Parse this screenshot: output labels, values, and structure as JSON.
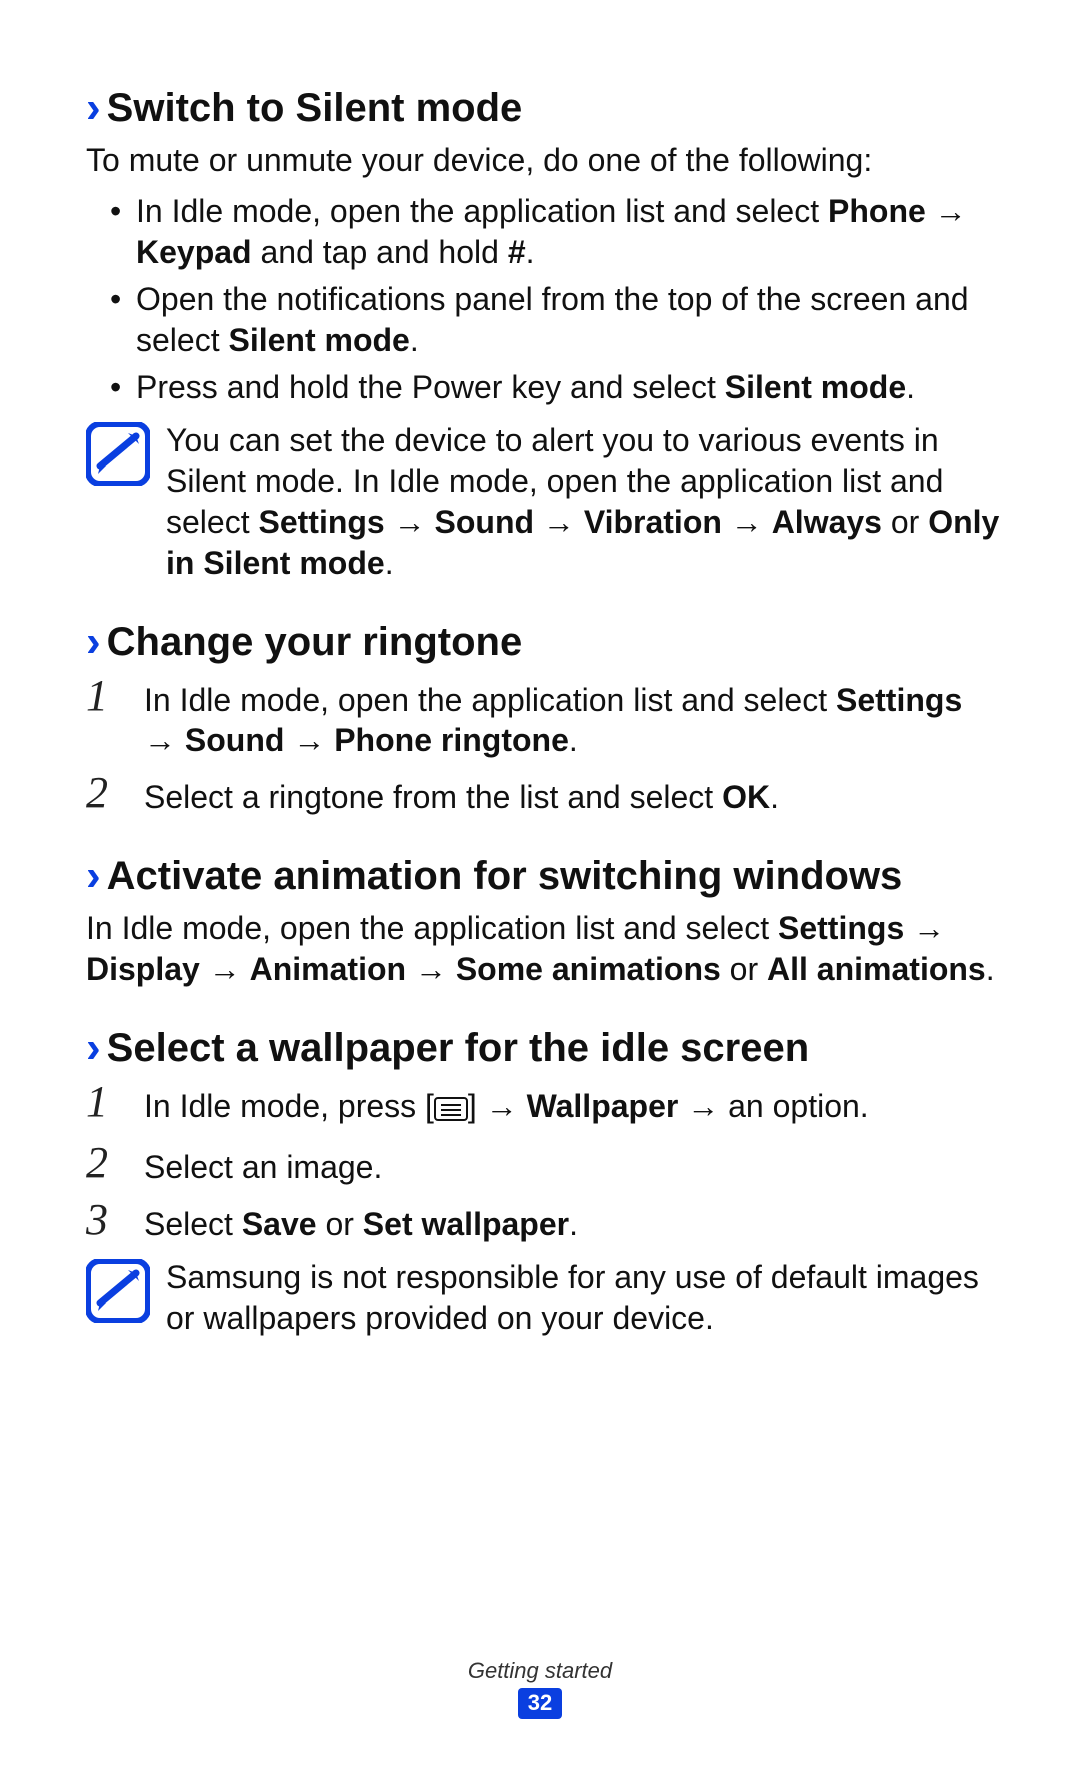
{
  "sections": {
    "silent": {
      "heading": "Switch to Silent mode",
      "intro": "To mute or unmute your device, do one of the following:",
      "bullets": {
        "b1_a": "In Idle mode, open the application list and select ",
        "b1_b": "Phone",
        "b1_c": " → ",
        "b1_d": "Keypad",
        "b1_e": " and tap and hold ",
        "b1_f": "#",
        "b1_g": ".",
        "b2_a": "Open the notifications panel from the top of the screen and select ",
        "b2_b": "Silent mode",
        "b2_c": ".",
        "b3_a": "Press and hold the Power key and select ",
        "b3_b": "Silent mode",
        "b3_c": "."
      },
      "note": {
        "a": "You can set the device to alert you to various events in Silent mode. In Idle mode, open the application list and select ",
        "b": "Settings",
        "c": " → ",
        "d": "Sound",
        "e": " → ",
        "f": "Vibration",
        "g": " → ",
        "h": "Always",
        "i": " or ",
        "j": "Only in Silent mode",
        "k": "."
      }
    },
    "ringtone": {
      "heading": "Change your ringtone",
      "step1": {
        "a": "In Idle mode, open the application list and select ",
        "b": "Settings",
        "c": " → ",
        "d": "Sound",
        "e": " → ",
        "f": "Phone ringtone",
        "g": "."
      },
      "step2": {
        "a": "Select a ringtone from the list and select ",
        "b": "OK",
        "c": "."
      }
    },
    "animation": {
      "heading": "Activate animation for switching windows",
      "text": {
        "a": "In Idle mode, open the application list and select ",
        "b": "Settings",
        "c": " → ",
        "d": "Display",
        "e": " → ",
        "f": "Animation",
        "g": " → ",
        "h": "Some animations",
        "i": " or ",
        "j": "All animations",
        "k": "."
      }
    },
    "wallpaper": {
      "heading": "Select a wallpaper for the idle screen",
      "step1": {
        "a": "In Idle mode, press [",
        "b": "] → ",
        "c": "Wallpaper",
        "d": " → an option."
      },
      "step2": "Select an image.",
      "step3": {
        "a": "Select ",
        "b": "Save",
        "c": " or ",
        "d": "Set wallpaper",
        "e": "."
      },
      "note": "Samsung is not responsible for any use of default images or wallpapers provided on your device."
    }
  },
  "nums": {
    "n1": "1",
    "n2": "2",
    "n3": "3"
  },
  "footer": {
    "label": "Getting started",
    "page": "32"
  }
}
